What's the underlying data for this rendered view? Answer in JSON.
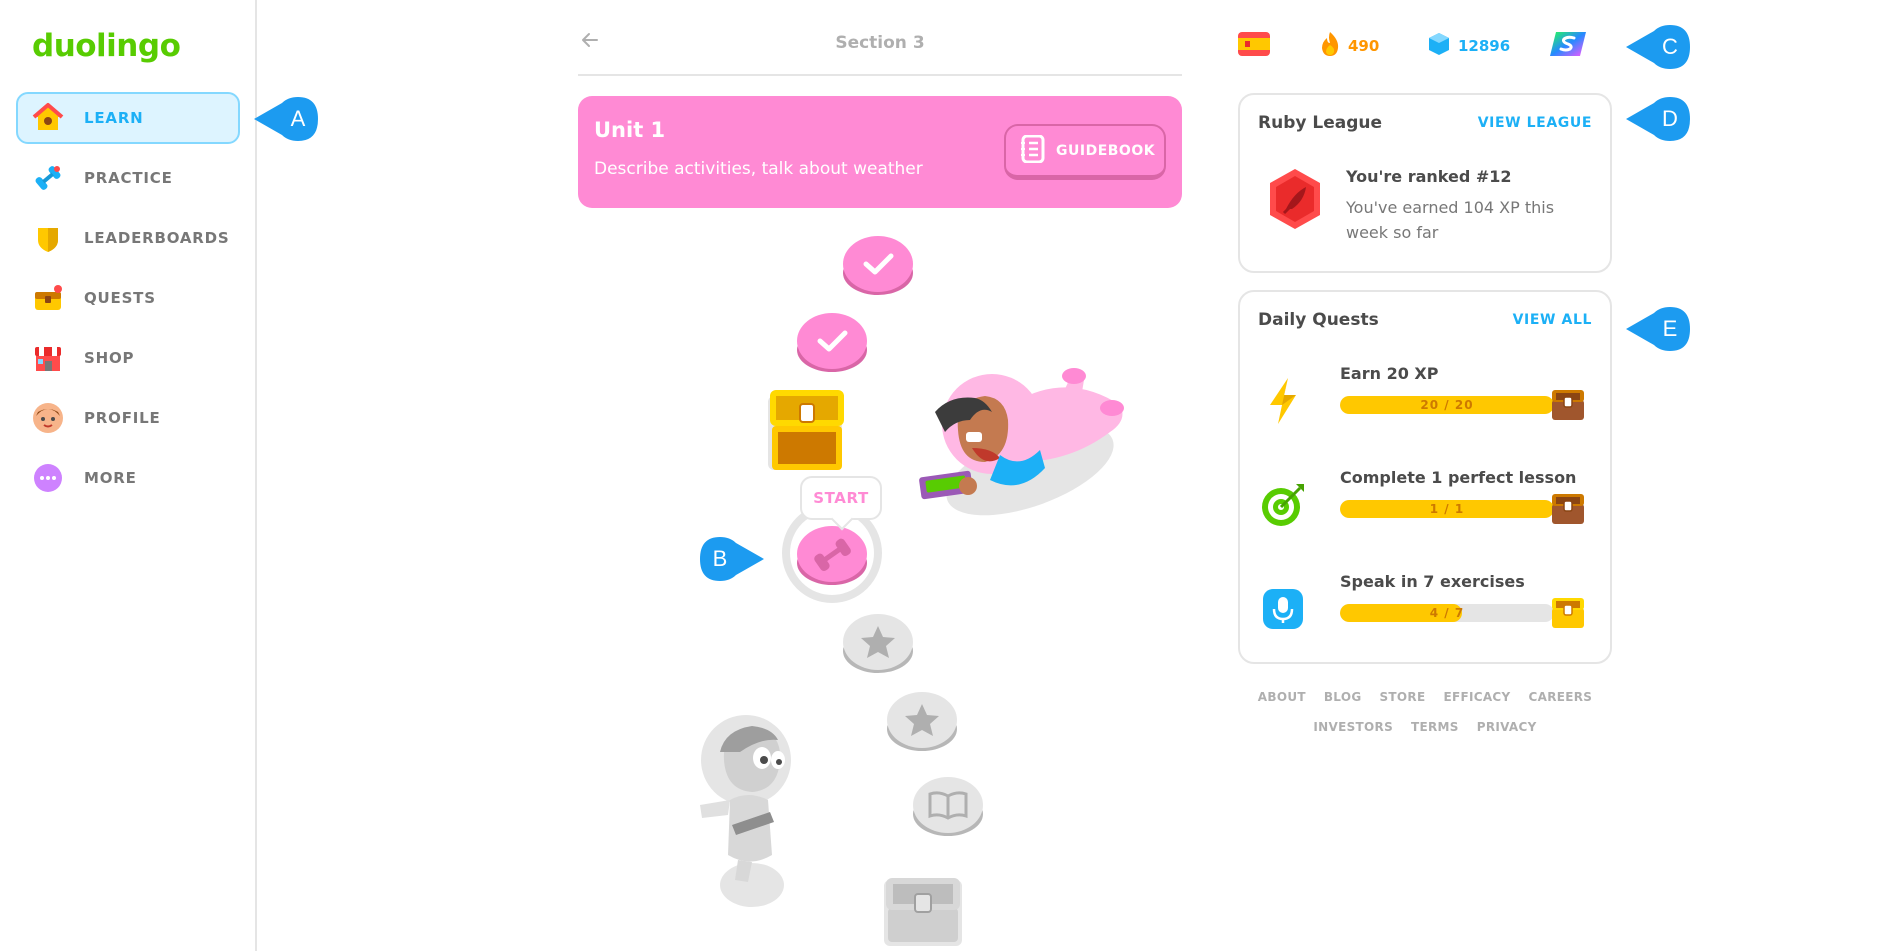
{
  "app": {
    "logo": "duolingo"
  },
  "sidebar": {
    "items": [
      {
        "label": "LEARN",
        "icon": "home-icon",
        "active": true
      },
      {
        "label": "PRACTICE",
        "icon": "dumbbell-icon",
        "active": false
      },
      {
        "label": "LEADERBOARDS",
        "icon": "shield-icon",
        "active": false
      },
      {
        "label": "QUESTS",
        "icon": "treasure-chest-icon",
        "active": false
      },
      {
        "label": "SHOP",
        "icon": "shop-icon",
        "active": false
      },
      {
        "label": "PROFILE",
        "icon": "avatar-icon",
        "active": false
      },
      {
        "label": "MORE",
        "icon": "more-dots-icon",
        "active": false
      }
    ]
  },
  "callouts": {
    "a": "A",
    "b": "B",
    "c": "C",
    "d": "D",
    "e": "E"
  },
  "main": {
    "section_title": "Section 3",
    "unit": {
      "title": "Unit 1",
      "description": "Describe activities, talk about weather",
      "guidebook_label": "GUIDEBOOK"
    },
    "start_label": "START",
    "path_nodes": [
      {
        "state": "completed",
        "icon": "check-icon"
      },
      {
        "state": "completed",
        "icon": "check-icon"
      },
      {
        "state": "chest",
        "icon": "treasure-chest-icon"
      },
      {
        "state": "current",
        "icon": "dumbbell-icon"
      },
      {
        "state": "locked",
        "icon": "star-icon"
      },
      {
        "state": "locked",
        "icon": "star-icon"
      },
      {
        "state": "locked",
        "icon": "book-icon"
      },
      {
        "state": "locked-chest",
        "icon": "treasure-chest-icon"
      }
    ]
  },
  "stats": {
    "language_flag": "spanish-flag-icon",
    "streak": "490",
    "gems": "12896",
    "super_icon": "super-icon"
  },
  "league": {
    "title": "Ruby League",
    "link": "VIEW LEAGUE",
    "rank_title": "You're ranked #12",
    "rank_desc": "You've earned 104 XP this week so far"
  },
  "quests": {
    "title": "Daily Quests",
    "link": "VIEW ALL",
    "items": [
      {
        "title": "Earn 20 XP",
        "progress": "20 / 20",
        "fraction": 1.0,
        "icon": "lightning-icon"
      },
      {
        "title": "Complete 1 perfect lesson",
        "progress": "1 / 1",
        "fraction": 1.0,
        "icon": "target-icon"
      },
      {
        "title": "Speak in 7 exercises",
        "progress": "4 / 7",
        "fraction": 0.571,
        "icon": "microphone-icon"
      }
    ]
  },
  "footer": {
    "row1": [
      "ABOUT",
      "BLOG",
      "STORE",
      "EFFICACY",
      "CAREERS"
    ],
    "row2": [
      "INVESTORS",
      "TERMS",
      "PRIVACY"
    ]
  },
  "colors": {
    "brand_green": "#58cc02",
    "accent_blue": "#1cb0f6",
    "unit_pink": "#ff8ad4",
    "streak_orange": "#ff9600",
    "quest_yellow": "#ffc800"
  }
}
